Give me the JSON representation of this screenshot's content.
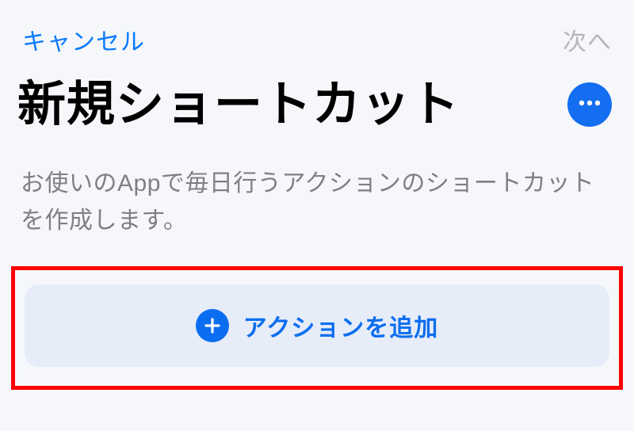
{
  "nav": {
    "cancel": "キャンセル",
    "next": "次へ"
  },
  "title": "新規ショートカット",
  "description": "お使いのAppで毎日行うアクションのショートカットを作成します。",
  "action_button": {
    "label": "アクションを追加"
  }
}
